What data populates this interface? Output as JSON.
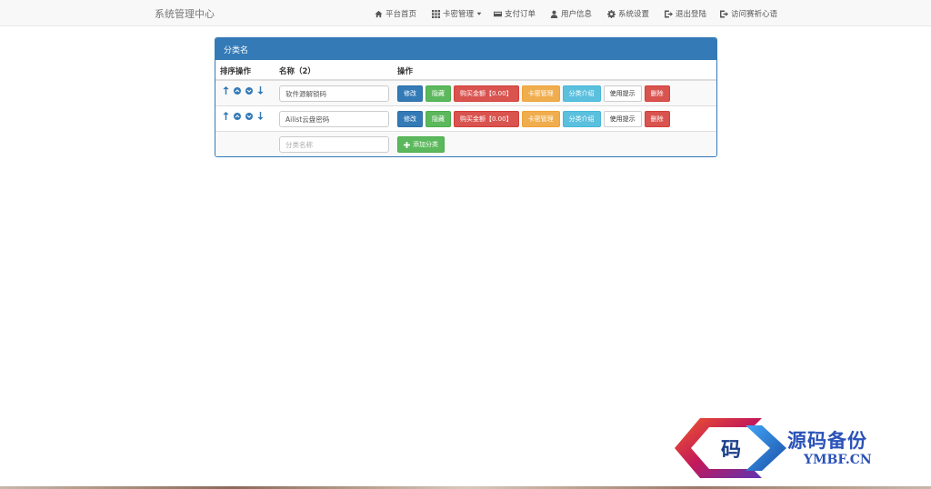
{
  "navbar": {
    "brand": "系统管理中心",
    "items": [
      {
        "label": "平台首页",
        "icon": "home-icon"
      },
      {
        "label": "卡密管理",
        "icon": "grid-icon"
      },
      {
        "label": "支付订单",
        "icon": "card-icon"
      },
      {
        "label": "用户信息",
        "icon": "user-icon"
      },
      {
        "label": "系统设置",
        "icon": "gear-icon"
      },
      {
        "label": "退出登陆",
        "icon": "logout-icon"
      },
      {
        "label": "访问赛祈心语",
        "icon": "external-icon"
      }
    ]
  },
  "panel": {
    "title": "分类名",
    "columns": [
      "排序操作",
      "名称（2）",
      "操作"
    ],
    "rows": [
      {
        "name": "软件源解锁码"
      },
      {
        "name": "Ailist云盘密码"
      }
    ],
    "actions": {
      "edit": "修改",
      "hide": "隐藏",
      "price": "购买金额【0.00】",
      "cards": "卡密管理",
      "intro": "分类介绍",
      "tips": "使用提示",
      "delete": "删除"
    },
    "add_row": {
      "placeholder": "分类名称",
      "button": "添加分类"
    }
  },
  "watermark": {
    "glyph": "码",
    "text": "源码备份",
    "sub": "YMBF.CN"
  },
  "colors": {
    "primary": "#337ab7",
    "success": "#5cb85c",
    "danger": "#d9534f",
    "warning": "#f0ad4e",
    "info": "#5bc0de"
  }
}
